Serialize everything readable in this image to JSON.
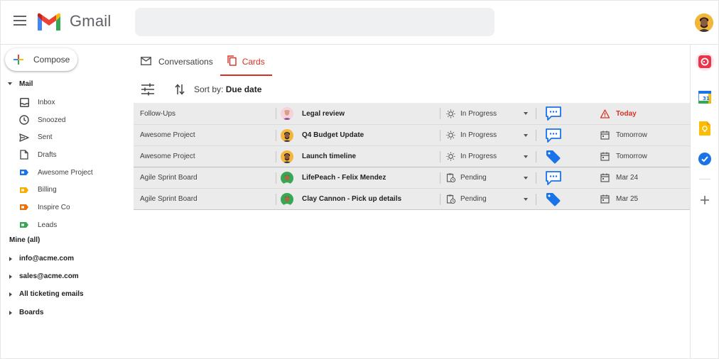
{
  "app": {
    "brand": "Gmail"
  },
  "header": {
    "search_placeholder": ""
  },
  "compose": {
    "label": "Compose"
  },
  "sidebar": {
    "mail_header": "Mail",
    "items": [
      {
        "label": "Inbox",
        "icon": "inbox-icon"
      },
      {
        "label": "Snoozed",
        "icon": "clock-icon"
      },
      {
        "label": "Sent",
        "icon": "send-icon"
      },
      {
        "label": "Drafts",
        "icon": "draft-icon"
      },
      {
        "label": "Awesome Project",
        "icon": "label-icon",
        "color": "#1a73e8"
      },
      {
        "label": "Billing",
        "icon": "label-icon",
        "color": "#f9ab00"
      },
      {
        "label": "Inspire Co",
        "icon": "label-icon",
        "color": "#e8710a"
      },
      {
        "label": "Leads",
        "icon": "label-icon",
        "color": "#34a853"
      }
    ],
    "mine_header": "Mine (all)",
    "accounts": [
      "info@acme.com",
      "sales@acme.com",
      "All ticketing emails",
      "Boards"
    ]
  },
  "tabs": [
    {
      "label": "Conversations",
      "active": false
    },
    {
      "label": "Cards",
      "active": true
    }
  ],
  "toolbar": {
    "sort_prefix": "Sort by:",
    "sort_value": "Due date"
  },
  "rows": [
    {
      "board": "Follow-Ups",
      "title": "Legal review",
      "status": "In Progress",
      "status_icon": "sun-icon",
      "msg": "chat",
      "due": "Today",
      "due_icon": "warning-icon",
      "urgent": true,
      "avatar": "#f6d2dc"
    },
    {
      "board": "Awesome Project",
      "title": "Q4 Budget Update",
      "status": "In Progress",
      "status_icon": "sun-icon",
      "msg": "chat",
      "due": "Tomorrow",
      "due_icon": "calendar-icon",
      "urgent": false,
      "avatar": "#f2b63b"
    },
    {
      "board": "Awesome Project",
      "title": "Launch timeline",
      "status": "In Progress",
      "status_icon": "sun-icon",
      "msg": "tag",
      "due": "Tomorrow",
      "due_icon": "calendar-icon",
      "urgent": false,
      "avatar": "#f2b63b"
    },
    {
      "board": "Agile Sprint Board",
      "title": "LifePeach - Felix Mendez",
      "status": "Pending",
      "status_icon": "clipboard-icon",
      "msg": "chat",
      "due": "Mar 24",
      "due_icon": "calendar-icon",
      "urgent": false,
      "avatar": "#34a853"
    },
    {
      "board": "Agile Sprint Board",
      "title": "Clay Cannon - Pick up details",
      "status": "Pending",
      "status_icon": "clipboard-icon",
      "msg": "tag",
      "due": "Mar 25",
      "due_icon": "calendar-icon",
      "urgent": false,
      "avatar": "#34a853"
    }
  ],
  "rail": [
    {
      "icon": "streak-icon",
      "color": "#e8364c"
    },
    {
      "icon": "calendar-app-icon",
      "color": "#1a73e8"
    },
    {
      "icon": "keep-icon",
      "color": "#fbbc04"
    },
    {
      "icon": "tasks-icon",
      "color": "#1a73e8"
    },
    {
      "icon": "add-icon",
      "color": "#5f6368"
    }
  ],
  "colors": {
    "accent": "#d93025",
    "chat": "#1a73e8",
    "selected_bg": "#ebebeb"
  }
}
